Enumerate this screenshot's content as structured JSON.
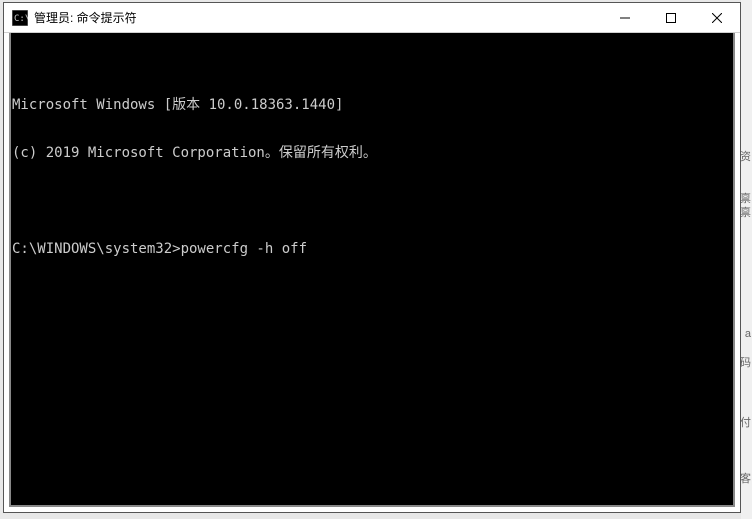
{
  "window": {
    "title": "管理员: 命令提示符"
  },
  "terminal": {
    "lines": [
      "Microsoft Windows [版本 10.0.18363.1440]",
      "(c) 2019 Microsoft Corporation。保留所有权利。",
      "",
      "C:\\WINDOWS\\system32>powercfg -h off",
      ""
    ],
    "prompt": "C:\\WINDOWS\\system32>",
    "last_command": "powercfg -h off"
  },
  "desktop_fragments": {
    "f1": "资",
    "f2": "禀",
    "f3": "禀",
    "f4": "a",
    "f5": "码",
    "f6": "付",
    "f7": "客"
  }
}
